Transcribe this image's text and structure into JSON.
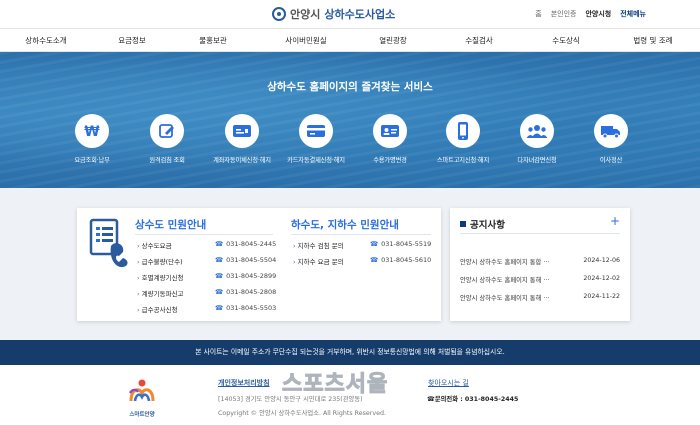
{
  "header": {
    "city": "안양시",
    "office": "상하수도사업소",
    "util": [
      "홈",
      "본인인증",
      "안양시청",
      "전체메뉴"
    ]
  },
  "gnb": [
    "상하수도소개",
    "요금정보",
    "물홍보관",
    "사이버민원실",
    "열린광장",
    "수질검사",
    "수도상식",
    "법령 및 조례"
  ],
  "hero": {
    "title": "상하수도 홈페이지의 즐겨찾는 서비스",
    "services": [
      {
        "label": "요금조회·납부",
        "icon": "won-icon"
      },
      {
        "label": "원격검침 조회",
        "icon": "edit-icon"
      },
      {
        "label": "계좌자동이체신청·해지",
        "icon": "bank-card-icon"
      },
      {
        "label": "카드자동결제신청·해지",
        "icon": "credit-card-icon"
      },
      {
        "label": "수용가명변경",
        "icon": "id-card-icon"
      },
      {
        "label": "스마트고지신청·해지",
        "icon": "smartphone-icon"
      },
      {
        "label": "다자녀감면신청",
        "icon": "people-icon"
      },
      {
        "label": "이사정산",
        "icon": "truck-icon"
      }
    ]
  },
  "civil": {
    "water_title": "상수도 민원안내",
    "water_rows": [
      {
        "name": "상수도요금",
        "tel": "031-8045-2445"
      },
      {
        "name": "급수불량(단수)",
        "tel": "031-8045-5504"
      },
      {
        "name": "호별계량기신청",
        "tel": "031-8045-2899"
      },
      {
        "name": "계량기동파신고",
        "tel": "031-8045-2808"
      },
      {
        "name": "급수공사신청",
        "tel": "031-8045-5503"
      }
    ],
    "sewer_title": "하수도, 지하수 민원안내",
    "sewer_rows": [
      {
        "name": "지하수 검침 문의",
        "tel": "031-8045-5519"
      },
      {
        "name": "지하수 요금 문의",
        "tel": "031-8045-5610"
      }
    ]
  },
  "notice": {
    "title": "공지사항",
    "plus": "+",
    "items": [
      {
        "title": "안양시 상하수도 홈페이지 통합 ···",
        "date": "2024-12-06"
      },
      {
        "title": "안양시 상하수도 홈페이지 통해 ···",
        "date": "2024-12-02"
      },
      {
        "title": "안양시 상하수도 홈페이지 통해 ···",
        "date": "2024-11-22"
      }
    ]
  },
  "notice_bar": "본 사이트는 이메일 주소가 무단수집 되는것을 거부하며, 위반시 정보통신망법에 의해 처벌됨을 유념하십시오.",
  "footer": {
    "smart_logo": "스마트안양",
    "privacy": "개인정보처리방침",
    "directions": "찾아오시는 길",
    "address": "[14053] 경기도 안양시 동안구 시민대로 235(관양동)",
    "phone": "문의전화 : 031-8045-2445",
    "copyright": "Copyright © 안양시 상하수도사업소. All Rights Reserved.",
    "watermark": "스포츠서울"
  },
  "colors": {
    "brand": "#2a5b9c",
    "accent": "#2a6ee0",
    "navy": "#153c6b"
  }
}
